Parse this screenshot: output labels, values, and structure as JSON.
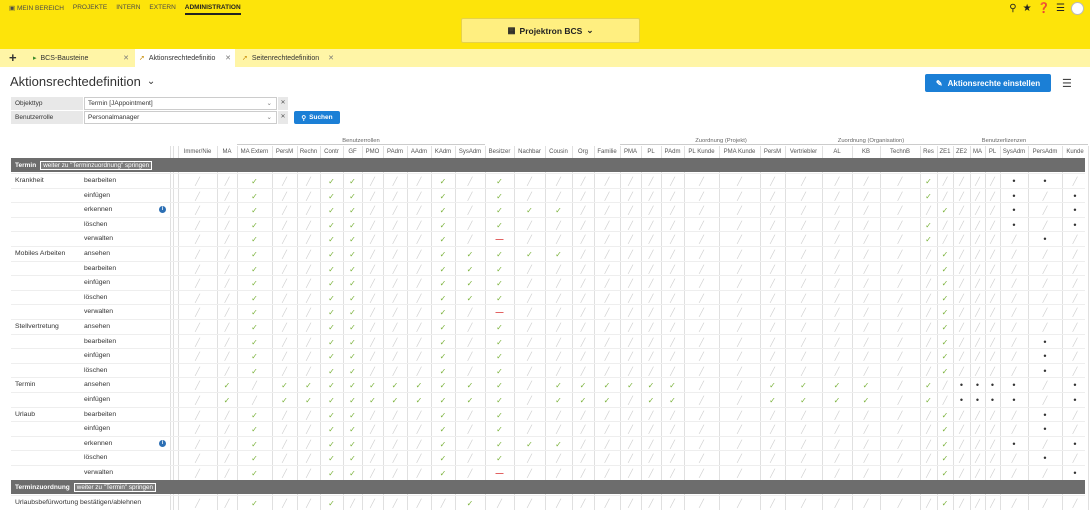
{
  "topnav": {
    "items": [
      "MEIN BEREICH",
      "PROJEKTE",
      "INTERN",
      "EXTERN",
      "ADMINISTRATION"
    ],
    "active": "ADMINISTRATION"
  },
  "top_right_icons": [
    "search-icon",
    "star-icon",
    "help-icon",
    "menu-icon",
    "avatar"
  ],
  "project_selector": "Projektron BCS",
  "tabs": [
    {
      "label": "BCS-Bausteine"
    },
    {
      "label": "Aktionsrechtedefinitio"
    },
    {
      "label": "Seitenrechtedefinition"
    }
  ],
  "page": {
    "title": "Aktionsrechtedefinition",
    "action_button": "Aktionsrechte einstellen"
  },
  "filters": [
    {
      "label": "Objekttyp",
      "value": "Termin [JAppointment]"
    },
    {
      "label": "Benutzerrolle",
      "value": "Personalmanager"
    }
  ],
  "search_button": "Suchen",
  "colors": {
    "accent": "#1b7fd6",
    "header_yellow": "#fde40a",
    "check_green": "#7bb23b",
    "section_gray": "#6d6d6d"
  },
  "column_groups": [
    {
      "label": "Benutzerrollen"
    },
    {
      "label": "Zuordnung (Projekt)"
    },
    {
      "label": "Zuordnung (Organisation)"
    },
    {
      "label": "Benutzerlizenzen"
    }
  ],
  "columns": [
    "Immer/Nie",
    "MA",
    "MA Extern",
    "PersM",
    "Rechn",
    "Contr",
    "GF",
    "PMO",
    "PAdm",
    "AAdm",
    "KAdm",
    "SysAdm",
    "Besitzer",
    "Nachbar",
    "Cousin",
    "Org",
    "Familie",
    "PMA",
    "PL",
    "PAdm",
    "PL Kunde",
    "PMA Kunde",
    "PersM",
    "Vertriebler",
    "AL",
    "KB",
    "TechnB",
    "Res",
    "ZE1",
    "ZE2",
    "MA",
    "PL",
    "SysAdm",
    "PersAdm",
    "Kunde"
  ],
  "sections": [
    {
      "label": "Termin",
      "jump": "weiter zu \"Terminzuordnung\" springen"
    },
    {
      "label": "Terminzuordnung",
      "jump": "weiter zu \"Termin\" springen"
    }
  ],
  "rows": [
    {
      "group": "Krankheit",
      "action": "bearbeiten",
      "info": false,
      "cells": "..c..ck...c.c..............c....pp.p.p..p."
    },
    {
      "group": "",
      "action": "einfügen",
      "info": false,
      "cells": "..c..ck...c.c..............c....p.p.p..p."
    },
    {
      "group": "",
      "action": "erkennen",
      "info": true,
      "cells": "..c..cc...c.ccc.............c...p.ppp..p."
    },
    {
      "group": "",
      "action": "löschen",
      "info": false,
      "cells": "..c..ck...c.c..............c....p.p.p..p."
    },
    {
      "group": "",
      "action": "verwalten",
      "info": false,
      "cells": "..c..ck...c.-..............c.....p.....p."
    },
    {
      "group": "Mobiles Arbeiten",
      "action": "ansehen",
      "info": false,
      "cells": "..c..ck...ccccc.............c......ppp..p."
    },
    {
      "group": "",
      "action": "bearbeiten",
      "info": false,
      "cells": "..c..ck...ccc...............c......ppp..p."
    },
    {
      "group": "",
      "action": "einfügen",
      "info": false,
      "cells": "..c..ck...ccc...............c......ppp..p."
    },
    {
      "group": "",
      "action": "löschen",
      "info": false,
      "cells": "..c..ck...ccc...............c......ppp..p."
    },
    {
      "group": "",
      "action": "verwalten",
      "info": false,
      "cells": "..c..ck...c.-...............c.......p....p."
    },
    {
      "group": "Stellvertretung",
      "action": "ansehen",
      "info": false,
      "cells": "..c..cc...c.c...............c..........p."
    },
    {
      "group": "",
      "action": "bearbeiten",
      "info": false,
      "cells": "..c..cc...c.c...............c....p...pp..p."
    },
    {
      "group": "",
      "action": "einfügen",
      "info": false,
      "cells": "..c..cc...c.c...............c....p...pp..p."
    },
    {
      "group": "",
      "action": "löschen",
      "info": false,
      "cells": "..c..cc...c.c...............c....p...pp..p."
    },
    {
      "group": "Termin",
      "action": "ansehen",
      "info": false,
      "cells": ".c.cccccccccc.cccccc..cccc.c.pppp.pp"
    },
    {
      "group": "",
      "action": "einfügen",
      "info": false,
      "cells": ".c.cccccccccc.ccc.cc..cccc.c.pppp.pp"
    },
    {
      "group": "Urlaub",
      "action": "bearbeiten",
      "info": false,
      "cells": "..c..ck...c.c...............c....p.ppp..p."
    },
    {
      "group": "",
      "action": "einfügen",
      "info": false,
      "cells": "..c..ck...c.c...............c....p.ppp..p."
    },
    {
      "group": "",
      "action": "erkennen",
      "info": true,
      "cells": "..c..cc...c.ccc.............c...p.ppp..p."
    },
    {
      "group": "",
      "action": "löschen",
      "info": false,
      "cells": "..c..ck...c.c...............c....p.ppp..p."
    },
    {
      "group": "",
      "action": "verwalten",
      "info": false,
      "cells": "..c..ck...c.-...............c.....p....p."
    },
    {
      "group": "Urlaubsbefürwortung bestätigen/ablehnen",
      "action": "",
      "info": false,
      "cells": "..c..c.....c................c.......ppp..p."
    }
  ]
}
